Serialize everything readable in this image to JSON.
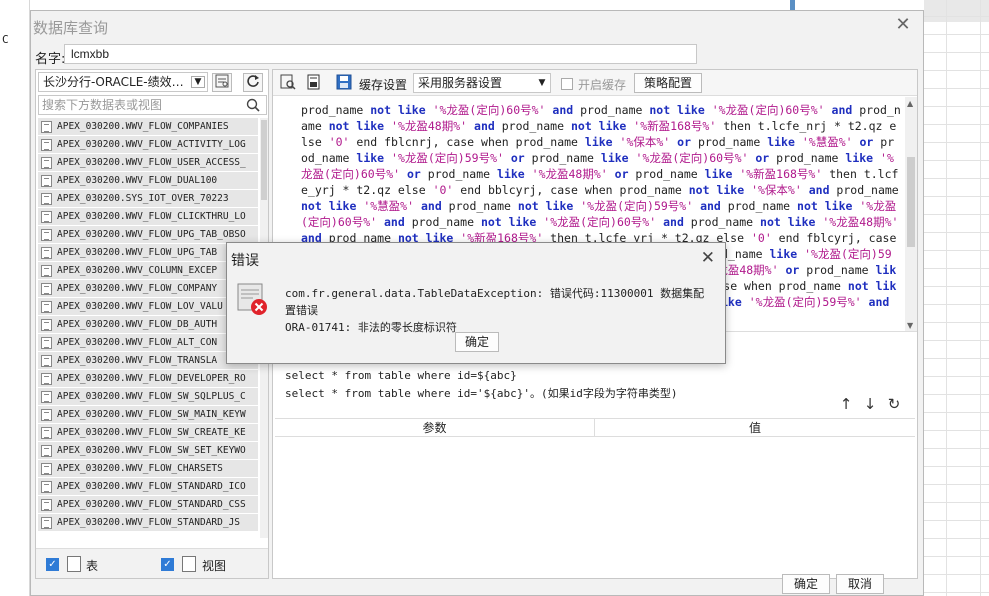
{
  "background": {
    "cell_text": "C"
  },
  "dialog": {
    "title": "数据库查询",
    "close_glyph": "✕",
    "name_label": "名字:",
    "name_value": "lcmxbb"
  },
  "left_panel": {
    "datasource": "长沙分行-ORACLE-绩效…",
    "search_placeholder": "搜索下方数据表或视图",
    "tables": [
      "APEX_030200.WWV_FLOW_COMPANIES",
      "APEX_030200.WWV_FLOW_ACTIVITY_LOG",
      "APEX_030200.WWV_FLOW_USER_ACCESS_",
      "APEX_030200.WWV_FLOW_DUAL100",
      "APEX_030200.SYS_IOT_OVER_70223",
      "APEX_030200.WWV_FLOW_CLICKTHRU_LO",
      "APEX_030200.WWV_FLOW_UPG_TAB_OBSO",
      "APEX_030200.WWV_FLOW_UPG_TAB",
      "APEX_030200.WWV_COLUMN_EXCEP",
      "APEX_030200.WWV_FLOW_COMPANY",
      "APEX_030200.WWV_FLOW_LOV_VALU",
      "APEX_030200.WWV_FLOW_DB_AUTH",
      "APEX_030200.WWV_FLOW_ALT_CON",
      "APEX_030200.WWV_FLOW_TRANSLA",
      "APEX_030200.WWV_FLOW_DEVELOPER_RO",
      "APEX_030200.WWV_FLOW_SW_SQLPLUS_C",
      "APEX_030200.WWV_FLOW_SW_MAIN_KEYW",
      "APEX_030200.WWV_FLOW_SW_CREATE_KE",
      "APEX_030200.WWV_FLOW_SW_SET_KEYWO",
      "APEX_030200.WWV_FLOW_CHARSETS",
      "APEX_030200.WWV_FLOW_STANDARD_ICO",
      "APEX_030200.WWV_FLOW_STANDARD_CSS",
      "APEX_030200.WWV_FLOW_STANDARD_JS"
    ],
    "footer_table_label": "表",
    "footer_view_label": "视图"
  },
  "toolbar": {
    "cache_label": "缓存设置",
    "cache_value": "采用服务器设置",
    "enable_cache_label": "开启缓存",
    "strategy_button": "策略配置"
  },
  "hint": {
    "line1": "select * from table where id=${abc}",
    "line2": "select * from table where id='${abc}'。(如果id字段为字符串类型)"
  },
  "param_table": {
    "col_param": "参数",
    "col_value": "值"
  },
  "main_buttons": {
    "ok": "确定",
    "cancel": "取消"
  },
  "error_dialog": {
    "title": "错误",
    "close_glyph": "✕",
    "message_line1": "com.fr.general.data.TableDataException: 错误代码:11300001 数据集配置错误",
    "message_line2": "ORA-01741: 非法的零长度标识符",
    "ok": "确定"
  }
}
